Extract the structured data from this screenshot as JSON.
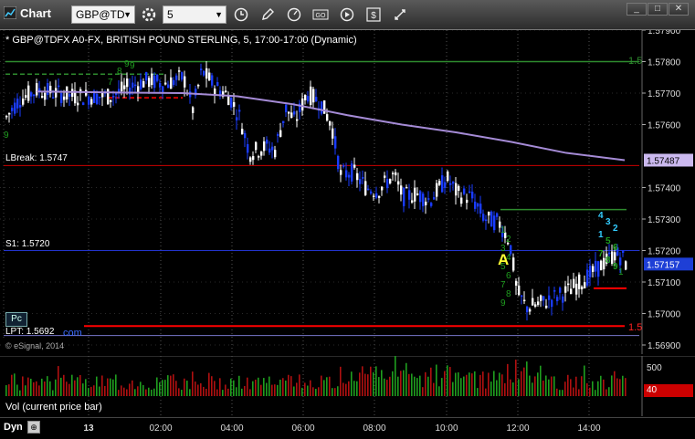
{
  "toolbar": {
    "title": "Chart",
    "symbol": "GBP@TD",
    "interval": "5"
  },
  "chart": {
    "header": "* GBP@TDFX A0-FX, BRITISH POUND STERLING, 5, 17:00-17:00 (Dynamic)",
    "copyright": "© eSignal, 2014",
    "lbreak_label": "LBreak: 1.5747",
    "s1_label": "S1: 1.5720",
    "lpt_label": "LPT: 1.5692",
    "pc_badge": "Pc",
    "com_text": "com",
    "marker_a": "A",
    "right_edge_top": "1.5",
    "right_edge_bottom": "1.5",
    "price_axis": [
      "1.57900",
      "1.57800",
      "1.57700",
      "1.57600",
      "1.57487",
      "1.57400",
      "1.57300",
      "1.57200",
      "1.57157",
      "1.57100",
      "1.57000",
      "1.56900"
    ],
    "current_price": "1.57157",
    "ma_price": "1.57487",
    "seq_labels_left": [
      "9",
      "7",
      "9",
      "8",
      "9"
    ],
    "seq_labels_mid": [
      "1",
      "2",
      "3",
      "4",
      "5",
      "6",
      "7",
      "8",
      "9"
    ],
    "seq_labels_right_top": [
      "4",
      "3",
      "2",
      "1",
      "5",
      "6",
      "7",
      "8",
      "9"
    ],
    "seq_label_right_bottom": "1"
  },
  "volume": {
    "label": "Vol (current price bar)",
    "scale_top": "500",
    "current": "40"
  },
  "time_axis": {
    "dyn": "Dyn",
    "labels": [
      "13",
      "02:00",
      "04:00",
      "06:00",
      "08:00",
      "10:00",
      "12:00",
      "14:00"
    ]
  },
  "colors": {
    "up_bar": "#ffffff",
    "down_bar": "#1a3cff",
    "ma": "#a58bd6",
    "lbreak": "#cc0000",
    "s1": "#2233cc",
    "resistance": "#2e8b2e",
    "lpt": "#ff0000"
  },
  "chart_data": {
    "type": "candlestick",
    "title": "GBP@TDFX A0-FX, BRITISH POUND STERLING, 5",
    "ylim": [
      1.5685,
      1.5795
    ],
    "levels": {
      "LBreak": 1.5747,
      "S1": 1.572,
      "LPT": 1.5692
    },
    "current_price": 1.57157,
    "ma_value": 1.57487
  }
}
